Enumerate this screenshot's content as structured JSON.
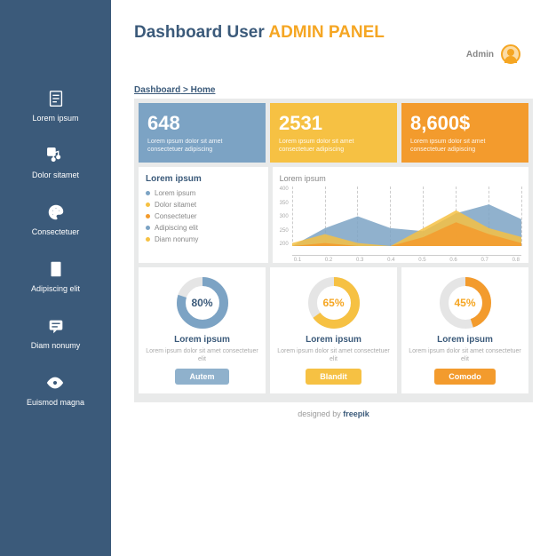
{
  "header": {
    "title_a": "Dashboard User",
    "title_b": "ADMIN PANEL",
    "user": "Admin"
  },
  "breadcrumb": {
    "a": "Dashboard",
    "b": "Home"
  },
  "sidebar": {
    "items": [
      {
        "label": "Lorem ipsum"
      },
      {
        "label": "Dolor sitamet"
      },
      {
        "label": "Consectetuer"
      },
      {
        "label": "Adipiscing elit"
      },
      {
        "label": "Diam nonumy"
      },
      {
        "label": "Euismod magna"
      }
    ]
  },
  "stats": [
    {
      "value": "648",
      "desc": "Lorem ipsum dolor sit amet consectetuer adipiscing",
      "color": "blue"
    },
    {
      "value": "2531",
      "desc": "Lorem ipsum dolor sit amet consectetuer adipiscing",
      "color": "yellow"
    },
    {
      "value": "8,600$",
      "desc": "Lorem ipsum dolor sit amet consectetuer adipiscing",
      "color": "orange"
    }
  ],
  "list": {
    "title": "Lorem ipsum",
    "items": [
      {
        "label": "Lorem ipsum",
        "color": "blue"
      },
      {
        "label": "Dolor sitamet",
        "color": "yellow"
      },
      {
        "label": "Consectetuer",
        "color": "orange"
      },
      {
        "label": "Adipiscing elit",
        "color": "blue"
      },
      {
        "label": "Diam nonumy",
        "color": "yellow"
      }
    ]
  },
  "chart_data": {
    "type": "area",
    "title": "Lorem ipsum",
    "ylabel": "",
    "xlabel": "",
    "ylim": [
      0,
      400
    ],
    "y_ticks": [
      400,
      350,
      300,
      250,
      200
    ],
    "categories": [
      "0.1",
      "0.2",
      "0.3",
      "0.4",
      "0.5",
      "0.6",
      "0.7",
      "0.8"
    ],
    "series": [
      {
        "name": "blue",
        "color": "#7ca3c4",
        "values": [
          200,
          260,
          300,
          260,
          250,
          310,
          340,
          290
        ]
      },
      {
        "name": "yellow",
        "color": "#f6c143",
        "values": [
          210,
          240,
          210,
          200,
          260,
          320,
          260,
          230
        ]
      },
      {
        "name": "orange",
        "color": "#f39b2d",
        "values": [
          200,
          210,
          200,
          200,
          230,
          280,
          240,
          210
        ]
      }
    ]
  },
  "donuts": [
    {
      "pct": 80,
      "color": "#7ca3c4",
      "pctColor": "#3b5a7a",
      "title": "Lorem ipsum",
      "desc": "Lorem ipsum dolor sit amet consectetuer elit",
      "btn": "Autem",
      "btnClass": "blue"
    },
    {
      "pct": 65,
      "color": "#f6c143",
      "pctColor": "#f5a623",
      "title": "Lorem ipsum",
      "desc": "Lorem ipsum dolor sit amet consectetuer elit",
      "btn": "Blandit",
      "btnClass": "yellow"
    },
    {
      "pct": 45,
      "color": "#f39b2d",
      "pctColor": "#f5a623",
      "title": "Lorem ipsum",
      "desc": "Lorem ipsum dolor sit amet consectetuer elit",
      "btn": "Comodo",
      "btnClass": "orange"
    }
  ],
  "footer": {
    "pre": "designed by ",
    "brand": "freepik"
  }
}
